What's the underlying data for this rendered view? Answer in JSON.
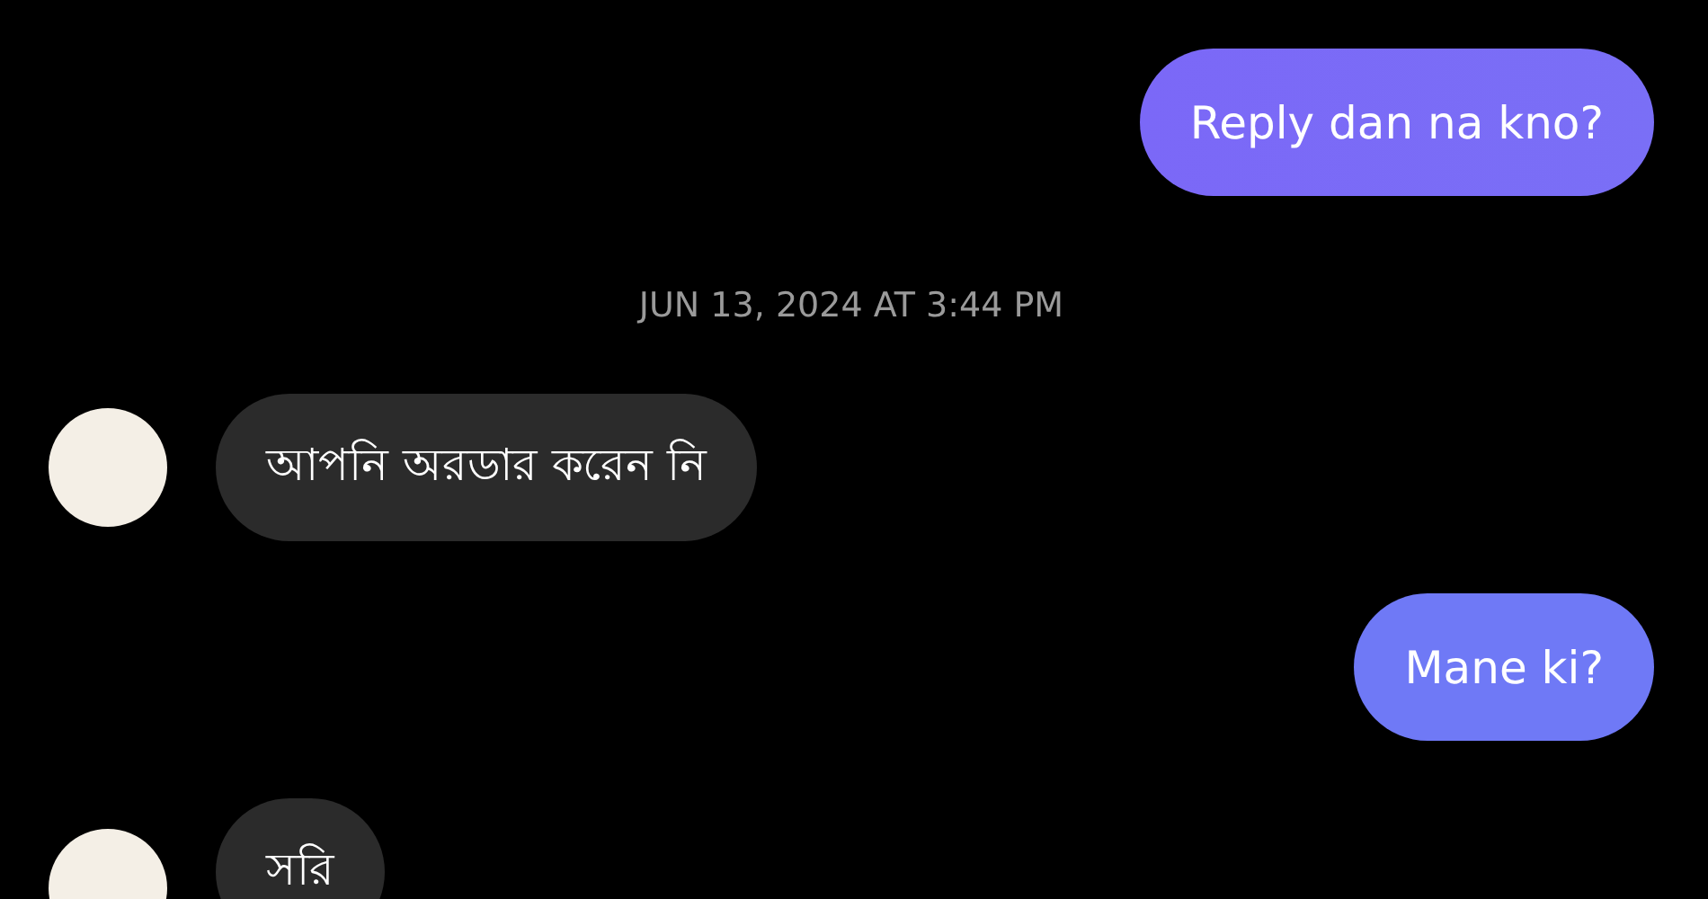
{
  "messages": [
    {
      "kind": "sent",
      "text": "Reply dan na kno?"
    },
    {
      "kind": "timestamp",
      "text": "JUN 13, 2024 AT 3:44 PM"
    },
    {
      "kind": "received",
      "text": "আপনি অরডার করেন নি"
    },
    {
      "kind": "sent",
      "text": "Mane ki?"
    },
    {
      "kind": "received",
      "text": "সরি"
    }
  ]
}
